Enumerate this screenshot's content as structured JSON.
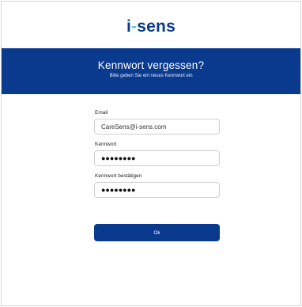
{
  "brand": {
    "logo_part1": "i",
    "logo_dash": "-",
    "logo_part2": "sens",
    "primary_color": "#0a3a8e",
    "accent_color": "#6fc3e8"
  },
  "banner": {
    "title": "Kennwort vergessen?",
    "subtitle": "Bitte geben Sie ein neues Kennwort ein"
  },
  "form": {
    "email_label": "Email",
    "email_value": "CareSens@i-sens.com",
    "password_label": "Kennwort",
    "password_value": "●●●●●●●●",
    "confirm_label": "Kennwort bestätigen",
    "confirm_value": "●●●●●●●●"
  },
  "actions": {
    "ok_label": "Ok"
  }
}
